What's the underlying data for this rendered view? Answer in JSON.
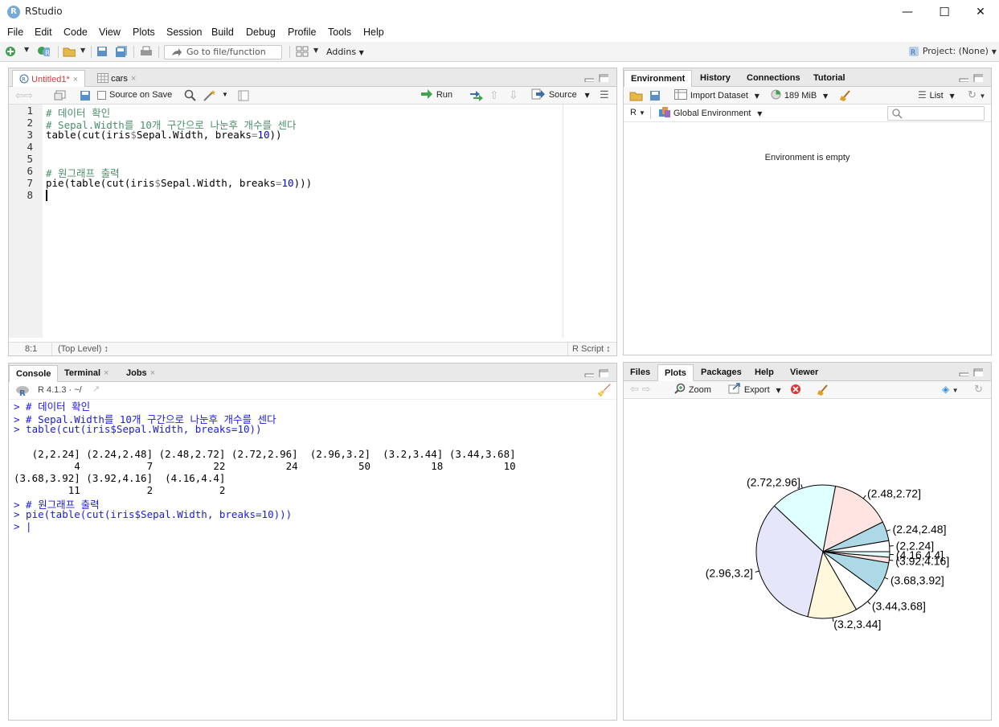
{
  "window": {
    "title": "RStudio",
    "min": "—",
    "max": "☐",
    "close": "✕"
  },
  "menu": [
    "File",
    "Edit",
    "Code",
    "View",
    "Plots",
    "Session",
    "Build",
    "Debug",
    "Profile",
    "Tools",
    "Help"
  ],
  "toolbar": {
    "goto_placeholder": "Go to file/function",
    "addins": "Addins",
    "project": "Project: (None)"
  },
  "editor": {
    "tabs": [
      {
        "label": "Untitled1*"
      },
      {
        "label": "cars"
      }
    ],
    "source_on_save": "Source on Save",
    "run": "Run",
    "source": "Source",
    "lines": [
      "1",
      "2",
      "3",
      "4",
      "5",
      "6",
      "7",
      "8"
    ],
    "code": {
      "l1": "# 데이터 확인",
      "l2": "# Sepal.Width를 10개 구간으로 나눈후 개수를 센다",
      "l3a": "table(cut(iris",
      "l3b": "$",
      "l3c": "Sepal.Width, breaks",
      "l3d": "=",
      "l3e": "10",
      "l3f": "))",
      "l6": "# 원그래프 출력",
      "l7a": "pie(table(cut(iris",
      "l7b": "$",
      "l7c": "Sepal.Width, breaks",
      "l7d": "=",
      "l7e": "10",
      "l7f": ")))"
    },
    "status_pos": "8:1",
    "status_level": "(Top Level) ↕",
    "status_type": "R Script ↕"
  },
  "console": {
    "tabs": [
      "Console",
      "Terminal",
      "Jobs"
    ],
    "version": "R 4.1.3 · ~/",
    "lines": [
      {
        "t": "in",
        "v": "> # 데이터 확인"
      },
      {
        "t": "in",
        "v": "> # Sepal.Width를 10개 구간으로 나눈후 개수를 센다"
      },
      {
        "t": "in",
        "v": "> table(cut(iris$Sepal.Width, breaks=10))"
      },
      {
        "t": "out",
        "v": ""
      },
      {
        "t": "out",
        "v": "   (2,2.24] (2.24,2.48] (2.48,2.72] (2.72,2.96]  (2.96,3.2]  (3.2,3.44] (3.44,3.68]"
      },
      {
        "t": "out",
        "v": "          4           7          22          24          50          18          10"
      },
      {
        "t": "out",
        "v": "(3.68,3.92] (3.92,4.16]  (4.16,4.4]"
      },
      {
        "t": "out",
        "v": "         11           2           2"
      },
      {
        "t": "in",
        "v": "> # 원그래프 출력"
      },
      {
        "t": "in",
        "v": "> pie(table(cut(iris$Sepal.Width, breaks=10)))"
      },
      {
        "t": "in",
        "v": "> |"
      }
    ]
  },
  "environment": {
    "tabs": [
      "Environment",
      "History",
      "Connections",
      "Tutorial"
    ],
    "import": "Import Dataset",
    "memory": "189 MiB",
    "view": "List",
    "lang": "R",
    "scope": "Global Environment",
    "empty": "Environment is empty"
  },
  "files": {
    "tabs": [
      "Files",
      "Plots",
      "Packages",
      "Help",
      "Viewer"
    ],
    "zoom": "Zoom",
    "export": "Export"
  },
  "chart_data": {
    "type": "pie",
    "categories": [
      "(2,2.24]",
      "(2.24,2.48]",
      "(2.48,2.72]",
      "(2.72,2.96]",
      "(2.96,3.2]",
      "(3.2,3.44]",
      "(3.44,3.68]",
      "(3.68,3.92]",
      "(3.92,4.16]",
      "(4.16,4.4]"
    ],
    "values": [
      4,
      7,
      22,
      24,
      50,
      18,
      10,
      11,
      2,
      2
    ],
    "colors": [
      "#ffffff",
      "#add8e6",
      "#ffe4e1",
      "#e0ffff",
      "#e6e6fa",
      "#fff8dc",
      "#ffffff",
      "#add8e6",
      "#ffe4e1",
      "#e0ffff"
    ],
    "start": "right, counter-clockwise"
  }
}
